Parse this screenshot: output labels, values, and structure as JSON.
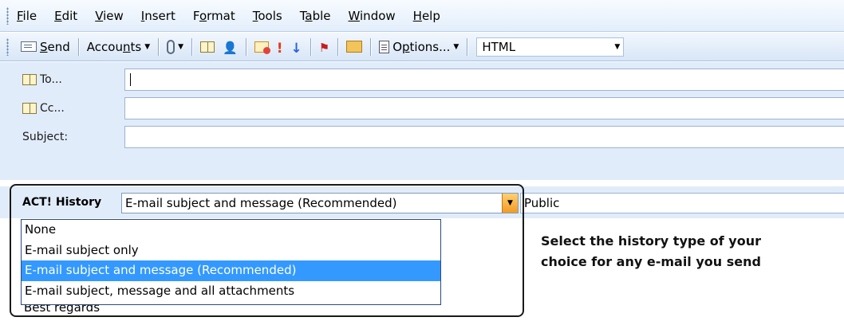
{
  "menu": {
    "items": [
      {
        "hot": "F",
        "rest": "ile"
      },
      {
        "hot": "E",
        "rest": "dit"
      },
      {
        "hot": "V",
        "rest": "iew"
      },
      {
        "hot": "I",
        "rest": "nsert"
      },
      {
        "pre": "F",
        "hot": "o",
        "rest": "rmat"
      },
      {
        "hot": "T",
        "rest": "ools"
      },
      {
        "pre": "T",
        "hot": "a",
        "rest": "ble"
      },
      {
        "hot": "W",
        "rest": "indow"
      },
      {
        "hot": "H",
        "rest": "elp"
      }
    ]
  },
  "toolbar": {
    "send": {
      "hot": "S",
      "rest": "end",
      "icon": "send-icon"
    },
    "accounts": {
      "pre": "Accou",
      "hot": "n",
      "rest": "ts",
      "caret": "▼"
    },
    "attach_caret": "▼",
    "options": {
      "pre": "O",
      "hot": "p",
      "rest": "tions...",
      "caret": "▼"
    },
    "format_value": "HTML",
    "format_caret": "▼"
  },
  "fields": {
    "to_label": "To...",
    "cc_label": "Cc...",
    "subject_label": "Subject:"
  },
  "act_history": {
    "label": "ACT! History",
    "selected_value": "E-mail subject and message (Recommended)",
    "drop_caret": "▼",
    "public_value": "Public",
    "options": [
      "None",
      "E-mail subject only",
      "E-mail subject and message (Recommended)",
      "E-mail subject, message and all attachments"
    ],
    "highlighted_index": 2
  },
  "body": {
    "visible_text": "Best regards"
  },
  "callout": {
    "line1": "Select the history type of your",
    "line2": "choice for any e-mail you send"
  },
  "colors": {
    "selection": "#3399ff",
    "chrome": "#e1ecfa",
    "dropdown_button": "#f29b22"
  }
}
